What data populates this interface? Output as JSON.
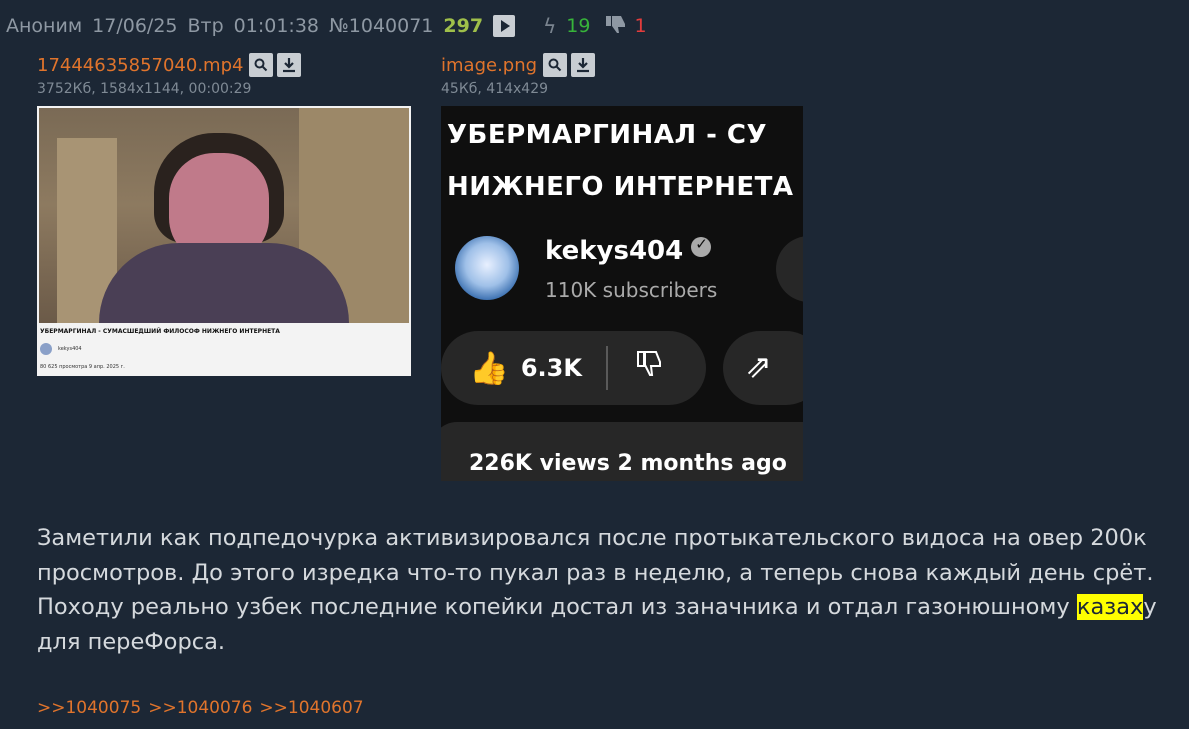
{
  "post": {
    "author": "Аноним",
    "date": "17/06/25",
    "weekday": "Втр",
    "time": "01:01:38",
    "number": "№1040071",
    "post_count": "297",
    "likes": "19",
    "dislikes": "1"
  },
  "files": [
    {
      "name": "17444635857040.mp4",
      "meta": "3752Кб, 1584x1144, 00:00:29"
    },
    {
      "name": "image.png",
      "meta": "45Кб, 414x429"
    }
  ],
  "video_preview": {
    "title": "УБЕРМАРГИНАЛ - СУМАСШЕДШИЙ ФИЛОСОФ НИЖНЕГО ИНТЕРНЕТА",
    "channel": "kekys404",
    "views": "80 625 просмотра 9 апр. 2025 г."
  },
  "image_preview": {
    "title_line1": "УБЕРМАРГИНАЛ - СУ",
    "title_line2": "НИЖНЕГО ИНТЕРНЕТА",
    "channel": "kekys404",
    "subscribers": "110K subscribers",
    "likes": "6.3K",
    "views": "226K views  2 months ago"
  },
  "comment": {
    "before": "Заметили как подпедочурка активизировался после протыкательского видоса на овер 200к просмотров. До этого изредка что-то пукал раз в неделю, а теперь снова каждый день срёт. Походу реально узбек последние копейки достал из заначника и отдал газонюшному ",
    "highlight": "казах",
    "after": "у для переФорса."
  },
  "replies": [
    ">>1040075",
    ">>1040076",
    ">>1040607"
  ],
  "colors": {
    "background": "#1c2735",
    "link": "#e0742c",
    "count": "#9fbf4a",
    "likes": "#37b43a",
    "dislikes": "#e23c3c",
    "highlight": "#ffff00"
  }
}
